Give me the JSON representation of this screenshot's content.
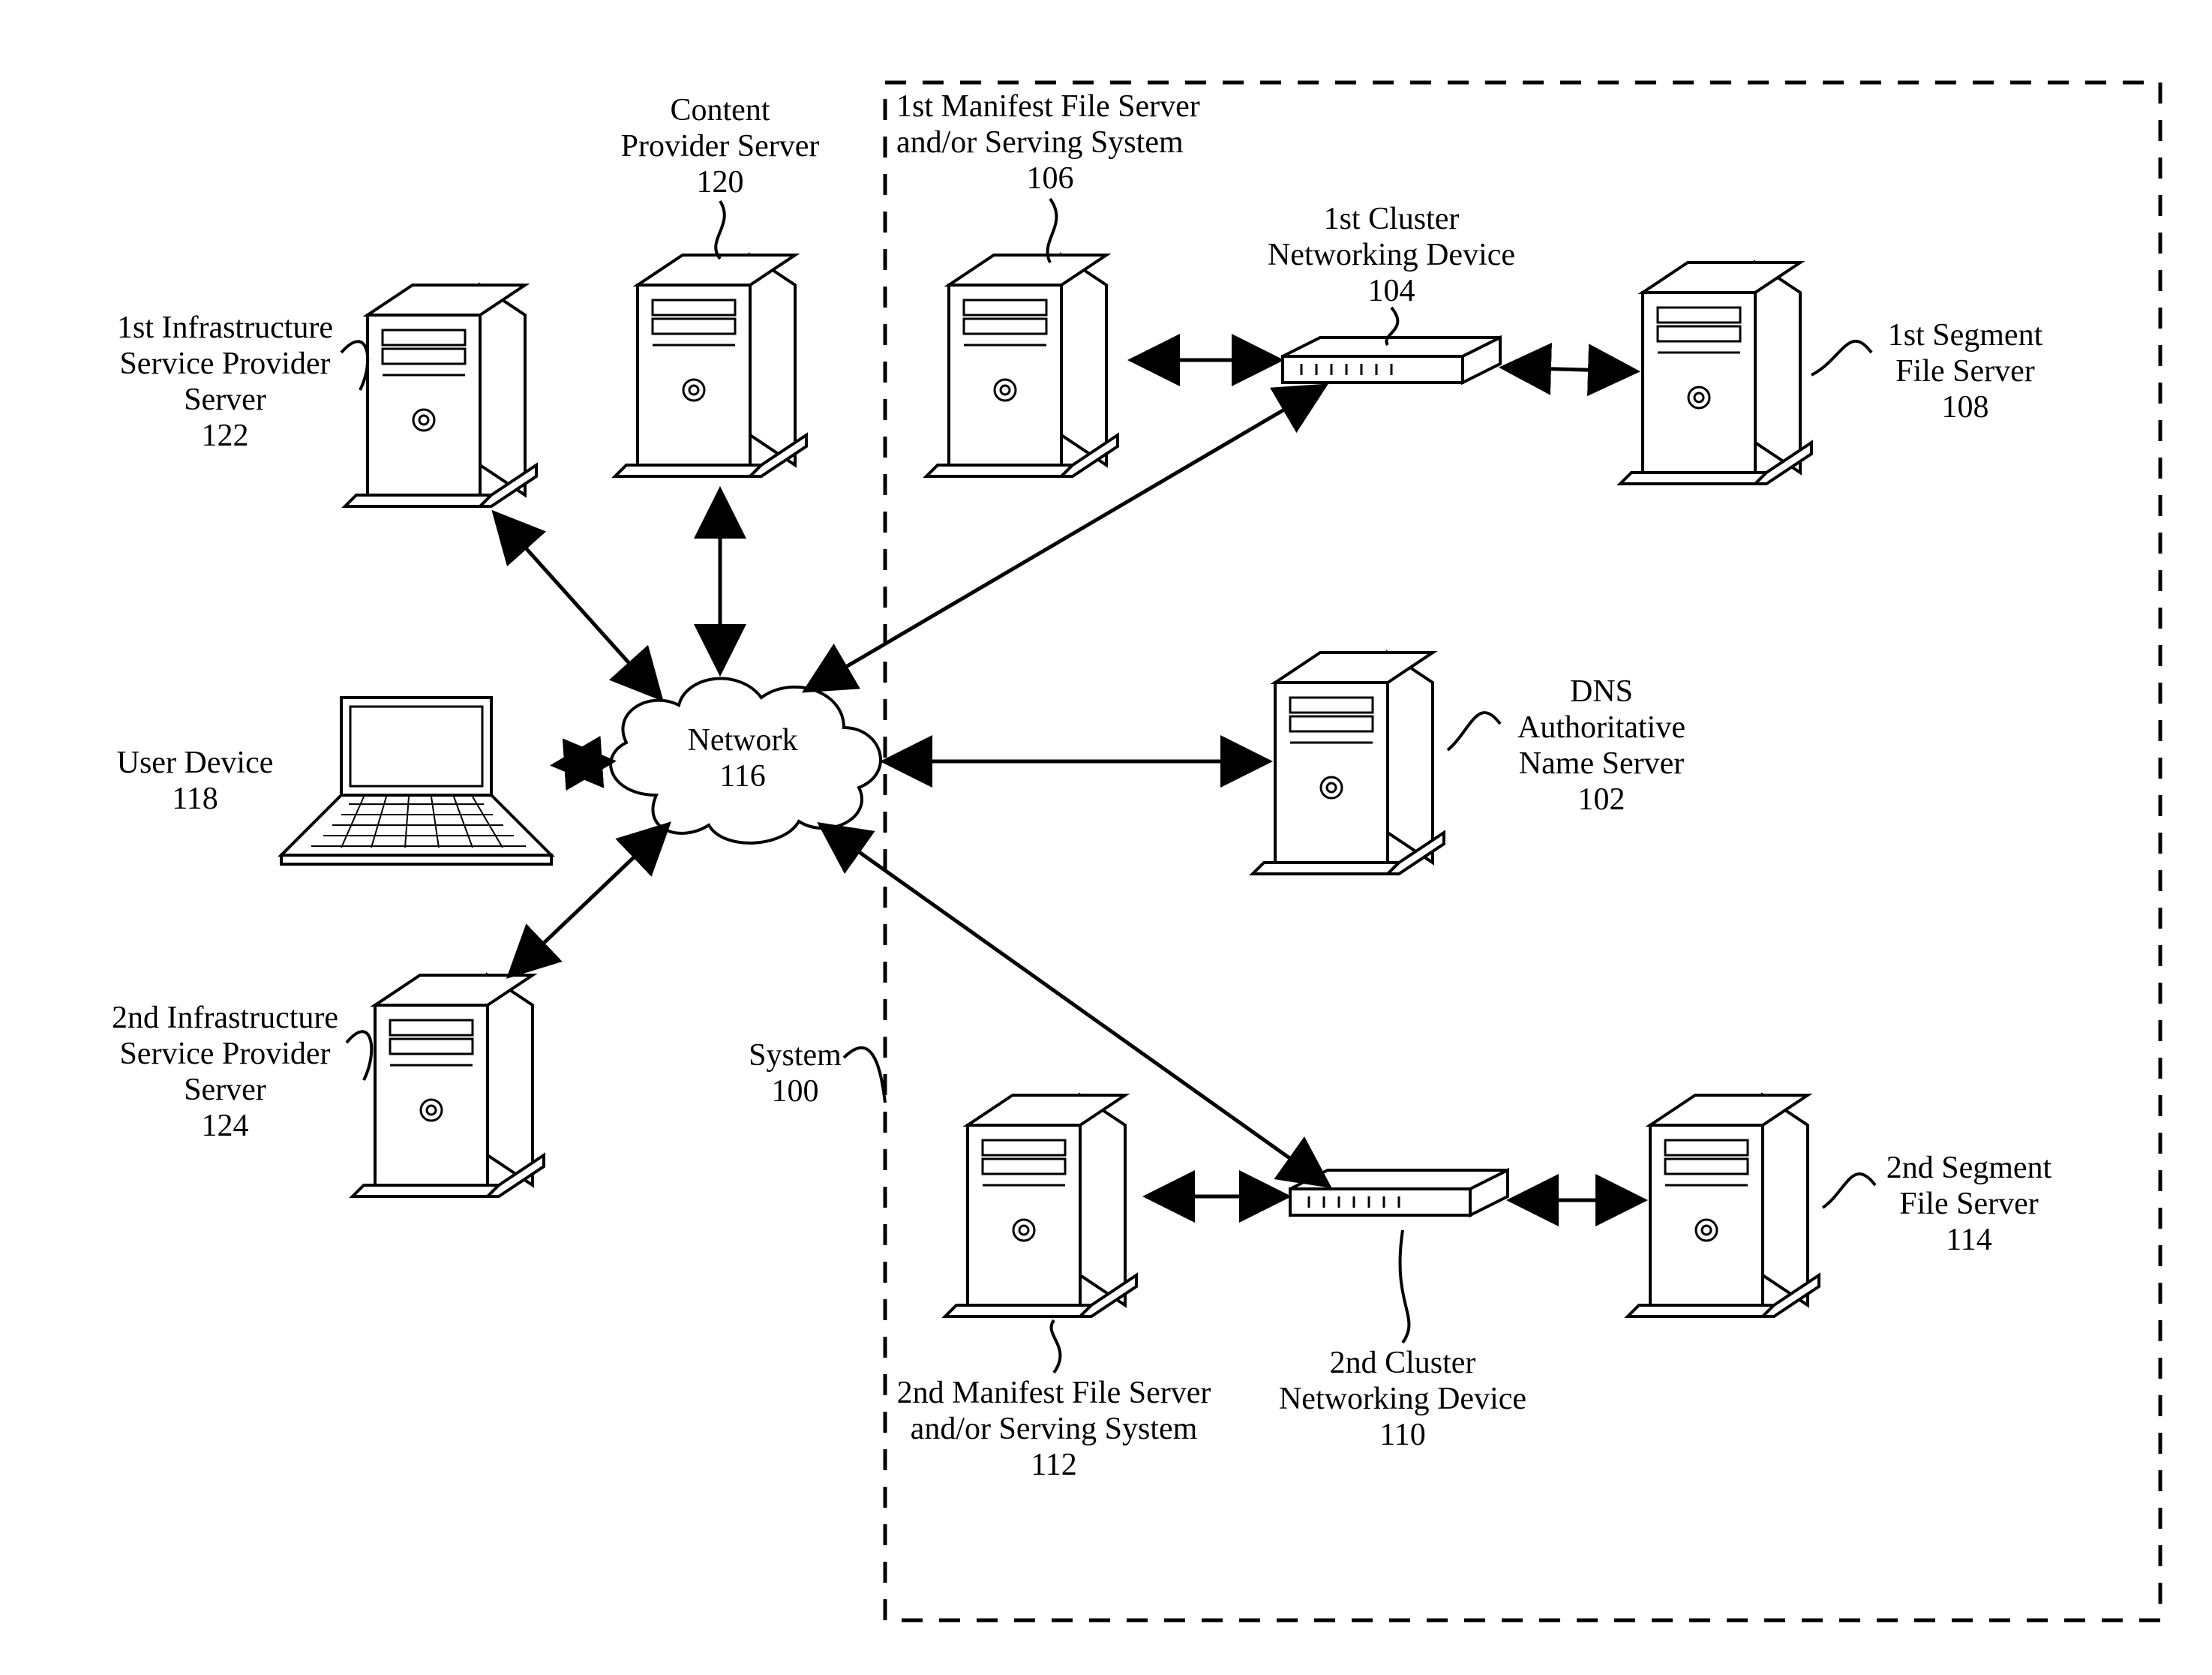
{
  "nodes": {
    "infra1": {
      "line1": "1st Infrastructure",
      "line2": "Service Provider",
      "line3": "Server",
      "num": "122"
    },
    "content": {
      "line1": "Content",
      "line2": "Provider Server",
      "num": "120"
    },
    "user": {
      "line1": "User Device",
      "num": "118"
    },
    "infra2": {
      "line1": "2nd Infrastructure",
      "line2": "Service Provider",
      "line3": "Server",
      "num": "124"
    },
    "network": {
      "line1": "Network",
      "num": "116"
    },
    "system": {
      "line1": "System",
      "num": "100"
    },
    "manifest1": {
      "line1": "1st Manifest File Server",
      "line2": "and/or Serving System",
      "num": "106"
    },
    "cluster1": {
      "line1": "1st Cluster",
      "line2": "Networking Device",
      "num": "104"
    },
    "segment1": {
      "line1": "1st Segment",
      "line2": "File Server",
      "num": "108"
    },
    "dns": {
      "line1": "DNS",
      "line2": "Authoritative",
      "line3": "Name Server",
      "num": "102"
    },
    "manifest2": {
      "line1": "2nd Manifest File Server",
      "line2": "and/or Serving System",
      "num": "112"
    },
    "cluster2": {
      "line1": "2nd Cluster",
      "line2": "Networking Device",
      "num": "110"
    },
    "segment2": {
      "line1": "2nd Segment",
      "line2": "File Server",
      "num": "114"
    }
  }
}
